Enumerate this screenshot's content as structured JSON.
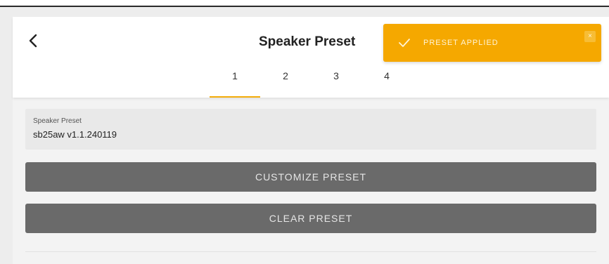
{
  "header": {
    "title": "Speaker Preset",
    "back_icon": "chevron-left-icon"
  },
  "tabs": [
    {
      "label": "1",
      "active": true
    },
    {
      "label": "2",
      "active": false
    },
    {
      "label": "3",
      "active": false
    },
    {
      "label": "4",
      "active": false
    }
  ],
  "toast": {
    "message": "PRESET APPLIED",
    "icon": "check-icon",
    "close_label": "×",
    "color": "#f5a800"
  },
  "preset_field": {
    "label": "Speaker Preset",
    "value": "sb25aw v1.1.240119"
  },
  "actions": {
    "customize_label": "CUSTOMIZE PRESET",
    "clear_label": "CLEAR PRESET"
  },
  "colors": {
    "accent": "#f3ac0a",
    "button_bg": "#6a6a6a"
  }
}
